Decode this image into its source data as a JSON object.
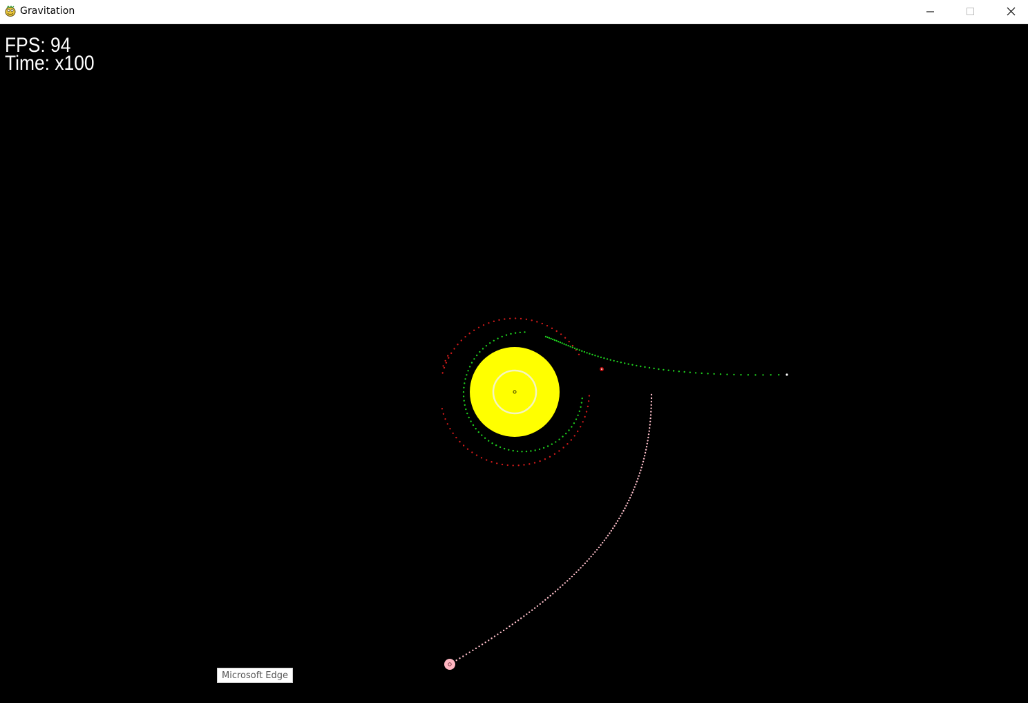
{
  "window": {
    "title": "Gravitation",
    "icon": "pygame-snake-icon",
    "controls": [
      "minimize-icon",
      "maximize-icon",
      "close-icon"
    ]
  },
  "hud": {
    "fps_text": "FPS: 94",
    "time_text": "Time: x100"
  },
  "bodies": [
    {
      "name": "sun",
      "color": "#ffff00"
    },
    {
      "name": "red-planet",
      "color": "#cc1f1f"
    },
    {
      "name": "green-planet",
      "color": "#22c422"
    },
    {
      "name": "pink-planet",
      "color": "#ffb6c1"
    }
  ],
  "colors": {
    "background": "#000000",
    "hud_text": "#ffffff",
    "red_trail": "#d01a1a",
    "green_trail": "#1ecf1e",
    "pink_trail": "#ffc0cb",
    "sun": "#ffff00"
  },
  "taskbar_tooltip": {
    "text": "Microsoft Edge"
  }
}
